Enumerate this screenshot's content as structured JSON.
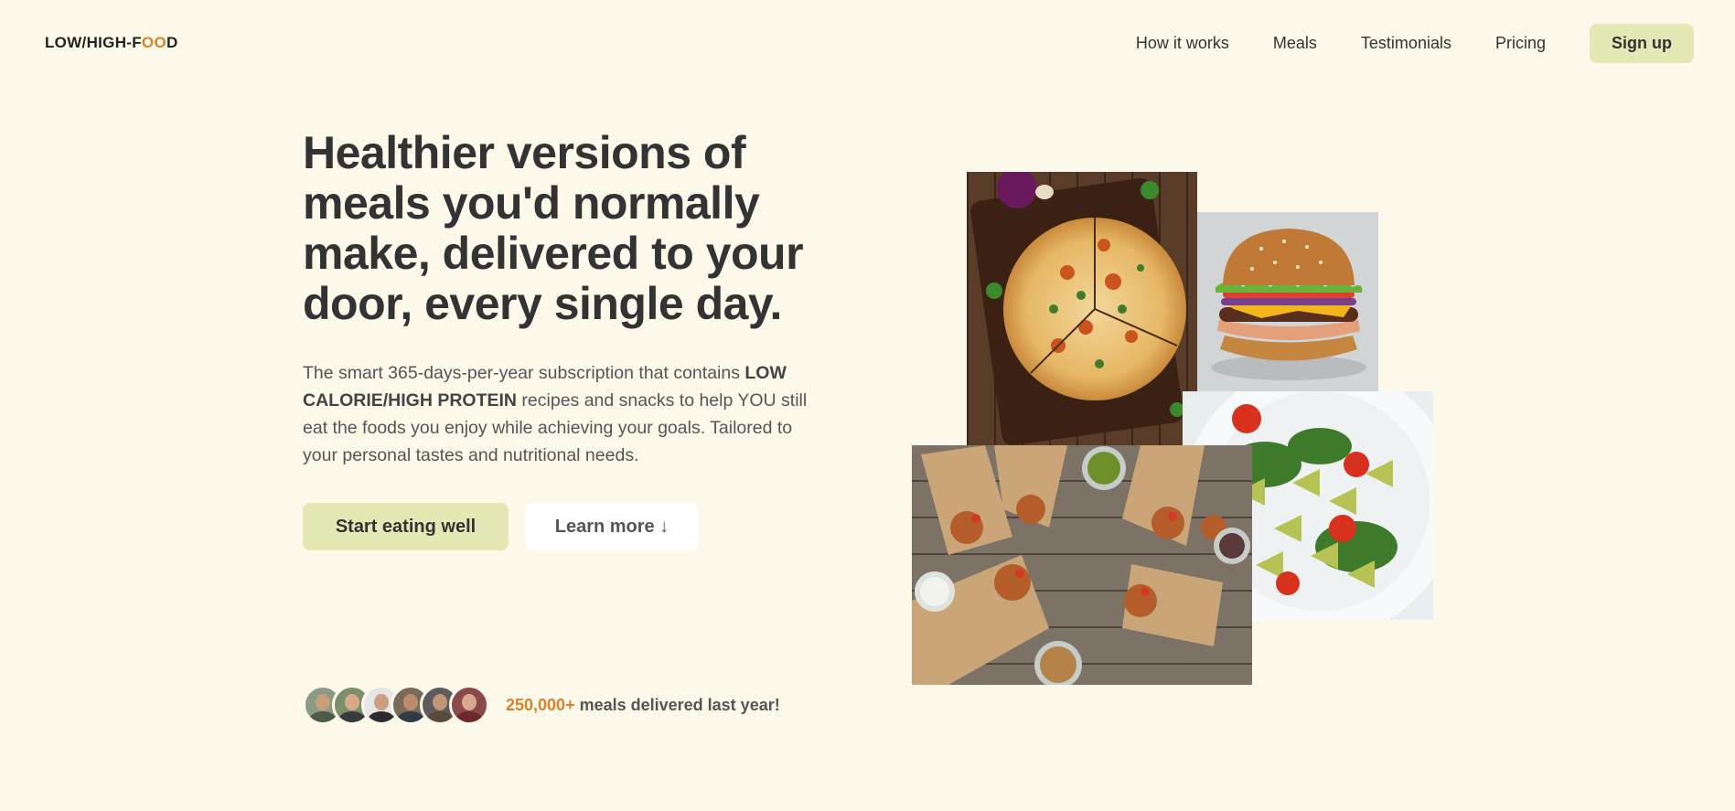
{
  "header": {
    "logo_prefix": "LOW/HIGH-F",
    "logo_accent": "OO",
    "logo_suffix": "D",
    "nav": [
      {
        "label": "How it works"
      },
      {
        "label": "Meals"
      },
      {
        "label": "Testimonials"
      },
      {
        "label": "Pricing"
      }
    ],
    "signup_label": "Sign up"
  },
  "hero": {
    "headline": "Healthier versions of meals you'd normally make, delivered to your door, every single day.",
    "description_part1": "The smart 365-days-per-year subscription that contains ",
    "description_bold": "LOW CALORIE/HIGH PROTEIN",
    "description_part2": " recipes and snacks to help YOU still eat the foods you enjoy while achieving your goals. Tailored to your personal tastes and nutritional needs.",
    "primary_cta": "Start eating well",
    "secondary_cta": "Learn more ↓"
  },
  "social_proof": {
    "count": "250,000+",
    "text": " meals delivered last year!"
  },
  "images": [
    {
      "name": "pizza-image"
    },
    {
      "name": "burger-image"
    },
    {
      "name": "pasta-salad-image"
    },
    {
      "name": "burritos-image"
    }
  ],
  "colors": {
    "background": "#fcf9ea",
    "accent": "#d9822b",
    "button": "#e3e8b5",
    "text": "#333333"
  }
}
